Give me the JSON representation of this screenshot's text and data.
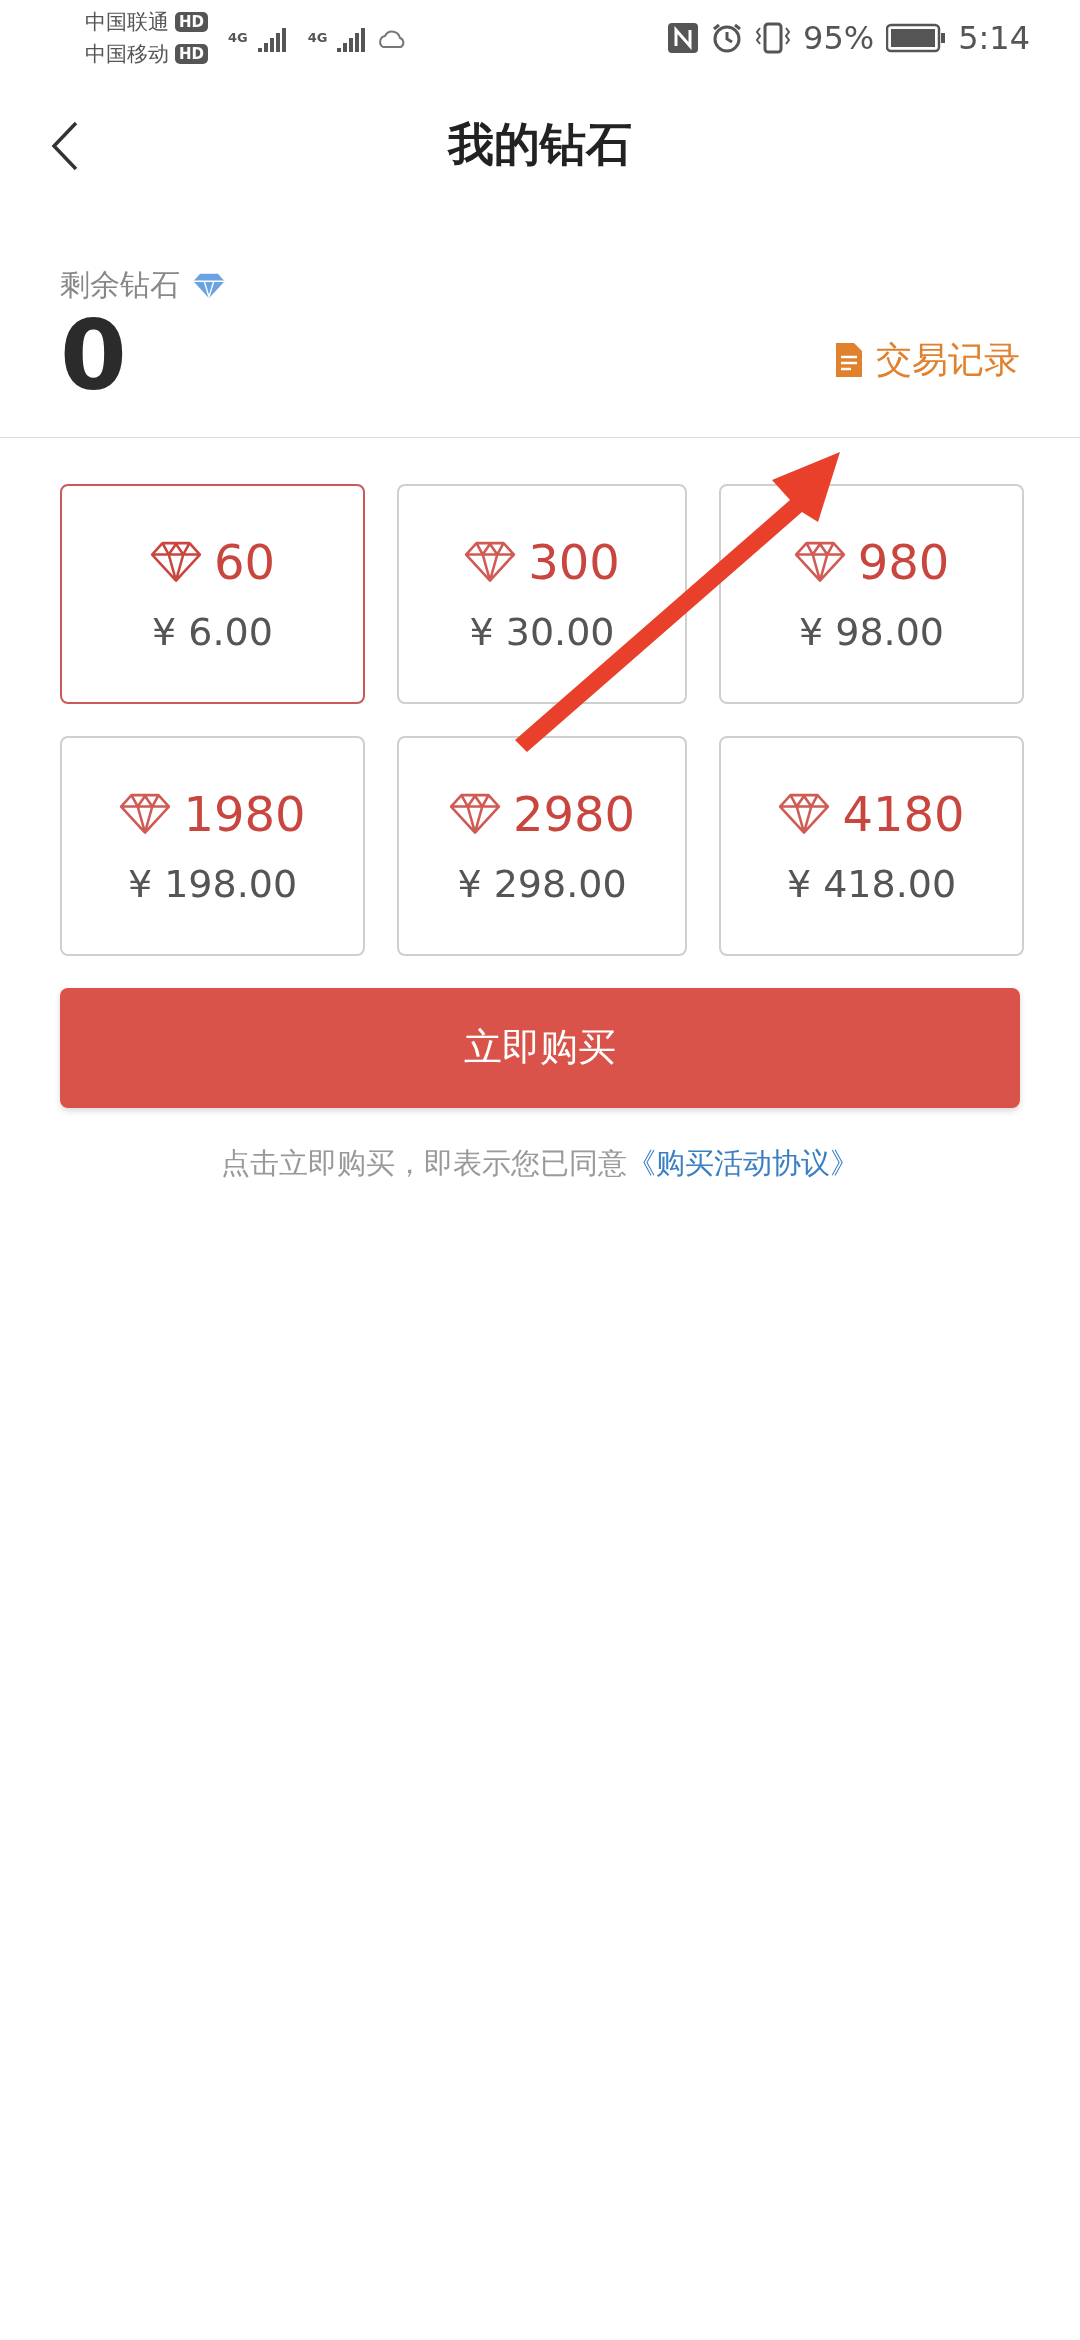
{
  "status_bar": {
    "carriers": [
      {
        "name": "中国联通",
        "badge": "HD",
        "network": "4G"
      },
      {
        "name": "中国移动",
        "badge": "HD",
        "network": "4G"
      }
    ],
    "battery_text": "95%",
    "time": "5:14"
  },
  "header": {
    "title": "我的钻石"
  },
  "balance": {
    "label": "剩余钻石",
    "value": "0",
    "link": "交易记录"
  },
  "packages": [
    {
      "amount": "60",
      "price": "¥ 6.00",
      "selected": true
    },
    {
      "amount": "300",
      "price": "¥ 30.00",
      "selected": false
    },
    {
      "amount": "980",
      "price": "¥ 98.00",
      "selected": false
    },
    {
      "amount": "1980",
      "price": "¥ 198.00",
      "selected": false
    },
    {
      "amount": "2980",
      "price": "¥ 298.00",
      "selected": false
    },
    {
      "amount": "4180",
      "price": "¥ 418.00",
      "selected": false
    }
  ],
  "buy_button": "立即购买",
  "agreement": {
    "text": "点击立即购买，即表示您已同意",
    "link": "《购买活动协议》"
  }
}
